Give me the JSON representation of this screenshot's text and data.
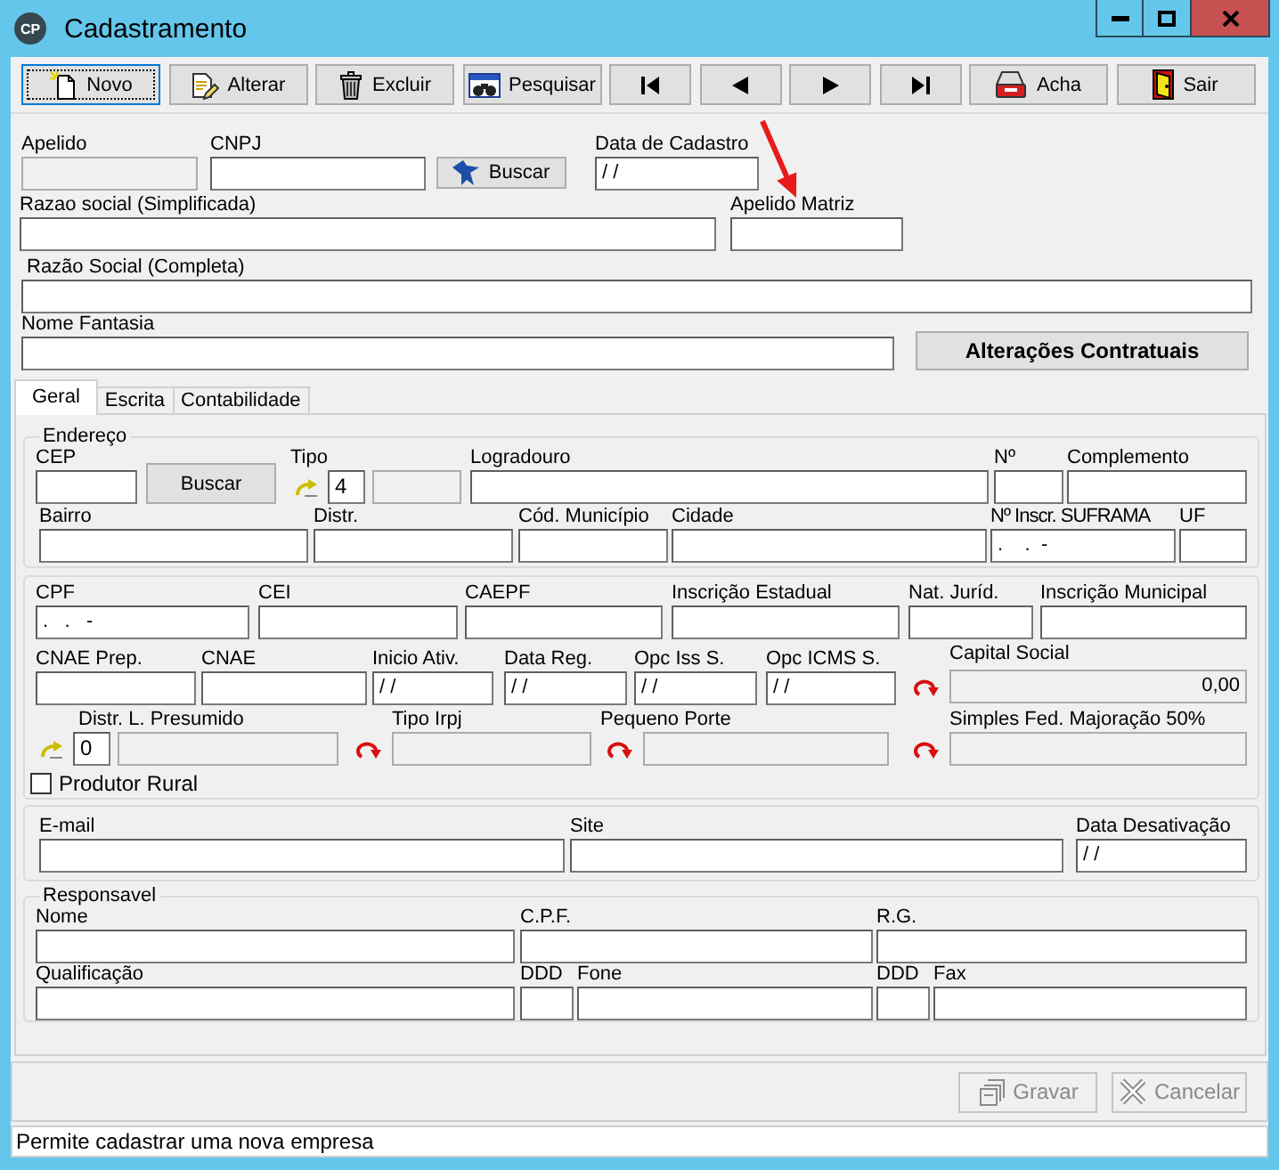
{
  "window": {
    "logo": "CP",
    "title": "Cadastramento"
  },
  "toolbar": [
    {
      "kind": "new",
      "label": "Novo",
      "focused": true
    },
    {
      "kind": "edit",
      "label": "Alterar",
      "focused": false
    },
    {
      "kind": "delete",
      "label": "Excluir",
      "focused": false
    },
    {
      "kind": "search",
      "label": "Pesquisar",
      "focused": false
    },
    {
      "kind": "first",
      "focused": false
    },
    {
      "kind": "previous",
      "focused": false
    },
    {
      "kind": "next",
      "focused": false
    },
    {
      "kind": "last",
      "focused": false
    },
    {
      "kind": "find",
      "label": "Acha",
      "focused": false
    },
    {
      "kind": "exit",
      "label": "Sair",
      "focused": false
    }
  ],
  "header": {
    "lines": [
      {
        "items": [
          {
            "kind": "field",
            "label": "Apelido",
            "disabled": true
          },
          {
            "kind": "field",
            "label": "CNPJ",
            "disabled": false
          },
          {
            "kind": "search",
            "label": "Buscar",
            "icon": true
          },
          {
            "kind": "field",
            "label": "Data de Cadastro",
            "value": "/ /",
            "disabled": false
          }
        ]
      },
      {
        "items": [
          {
            "kind": "field",
            "label": "Razao social (Simplificada)",
            "disabled": false
          },
          {
            "kind": "field",
            "label": "Apelido Matriz",
            "disabled": false
          }
        ]
      },
      {
        "items": [
          {
            "kind": "field",
            "label": "Razão Social (Completa)",
            "disabled": false
          }
        ]
      },
      {
        "items": [
          {
            "kind": "field",
            "label": "Nome Fantasia",
            "disabled": false
          },
          {
            "kind": "command",
            "label": "Alterações Contratuais",
            "icon": false
          }
        ]
      }
    ]
  },
  "tabs": [
    {
      "label": "Geral",
      "selected": true
    },
    {
      "label": "Escrita",
      "selected": false
    },
    {
      "label": "Contabilidade",
      "selected": false
    }
  ],
  "groups": [
    {
      "title": "Endereço",
      "lines": [
        {
          "items": [
            {
              "kind": "field",
              "label": "CEP",
              "disabled": false
            },
            {
              "kind": "search",
              "label": "Buscar",
              "icon": false
            },
            {
              "kind": "coded",
              "label": "Tipo",
              "code": "4",
              "disabled": true
            },
            {
              "kind": "field",
              "label": "Logradouro",
              "disabled": false
            },
            {
              "kind": "field",
              "label": "Nº",
              "disabled": false
            },
            {
              "kind": "field",
              "label": "Complemento",
              "disabled": false
            }
          ]
        },
        {
          "items": [
            {
              "kind": "field",
              "label": "Bairro",
              "disabled": false
            },
            {
              "kind": "field",
              "label": "Distr.",
              "disabled": false
            },
            {
              "kind": "field",
              "label": "Cód. Município",
              "disabled": false
            },
            {
              "kind": "field",
              "label": "Cidade",
              "disabled": false
            },
            {
              "kind": "field",
              "label": "Nº Inscr. SUFRAMA",
              "value": ".    .  -",
              "disabled": false
            },
            {
              "kind": "field",
              "label": "UF",
              "disabled": false
            }
          ]
        }
      ]
    },
    {
      "lines": [
        {
          "items": [
            {
              "kind": "field",
              "label": "CPF",
              "value": ".   .   -",
              "disabled": false
            },
            {
              "kind": "field",
              "label": "CEI",
              "disabled": false
            },
            {
              "kind": "field",
              "label": "CAEPF",
              "disabled": false
            },
            {
              "kind": "field",
              "label": "Inscrição Estadual",
              "disabled": false
            },
            {
              "kind": "field",
              "label": "Nat. Juríd.",
              "disabled": false
            },
            {
              "kind": "field",
              "label": "Inscrição Municipal",
              "disabled": false
            }
          ]
        },
        {
          "items": [
            {
              "kind": "field",
              "label": "CNAE Prep.",
              "disabled": false
            },
            {
              "kind": "field",
              "label": "CNAE",
              "disabled": false
            },
            {
              "kind": "field",
              "label": "Inicio Ativ.",
              "value": "/ /",
              "disabled": false
            },
            {
              "kind": "field",
              "label": "Data Reg.",
              "value": "/ /",
              "disabled": false
            },
            {
              "kind": "field",
              "label": "Opc Iss S.",
              "value": "/ /",
              "disabled": false
            },
            {
              "kind": "field",
              "label": "Opc ICMS S.",
              "value": "/ /",
              "disabled": false
            },
            {
              "kind": "refresh",
              "label": "Capital Social",
              "value": "0,00",
              "disabled": true
            }
          ]
        },
        {
          "items": [
            {
              "kind": "coded",
              "label": "Distr. L. Presumido",
              "code": "0",
              "disabled": true
            },
            {
              "kind": "refresh",
              "label": "Tipo Irpj",
              "disabled": true
            },
            {
              "kind": "refresh",
              "label": "Pequeno Porte",
              "disabled": true
            },
            {
              "kind": "refresh",
              "label": "Simples Fed. Majoração 50%",
              "disabled": true
            }
          ]
        }
      ],
      "checkbox": {
        "label": "Produtor Rural",
        "checked": false
      }
    },
    {
      "lines": [
        {
          "items": [
            {
              "kind": "field",
              "label": "E-mail",
              "disabled": false
            },
            {
              "kind": "field",
              "label": "Site",
              "disabled": false
            },
            {
              "kind": "field",
              "label": "Data Desativação",
              "value": "/ /",
              "disabled": false
            }
          ]
        }
      ]
    },
    {
      "title": "Responsavel",
      "lines": [
        {
          "items": [
            {
              "kind": "field",
              "label": "Nome",
              "disabled": false
            },
            {
              "kind": "field",
              "label": "C.P.F.",
              "disabled": false
            },
            {
              "kind": "field",
              "label": "R.G.",
              "disabled": false
            }
          ]
        },
        {
          "items": [
            {
              "kind": "field",
              "label": "Qualificação",
              "disabled": false
            },
            {
              "kind": "field",
              "label": "DDD",
              "disabled": false
            },
            {
              "kind": "field",
              "label": "Fone",
              "disabled": false
            },
            {
              "kind": "field",
              "label": "DDD",
              "disabled": false
            },
            {
              "kind": "field",
              "label": "Fax",
              "disabled": false
            }
          ]
        }
      ]
    }
  ],
  "actions": [
    {
      "kind": "save",
      "label": "Gravar",
      "disabled": true
    },
    {
      "kind": "cancel",
      "label": "Cancelar",
      "disabled": true
    }
  ],
  "status_bar": {
    "text": "Permite cadastrar uma nova empresa"
  }
}
